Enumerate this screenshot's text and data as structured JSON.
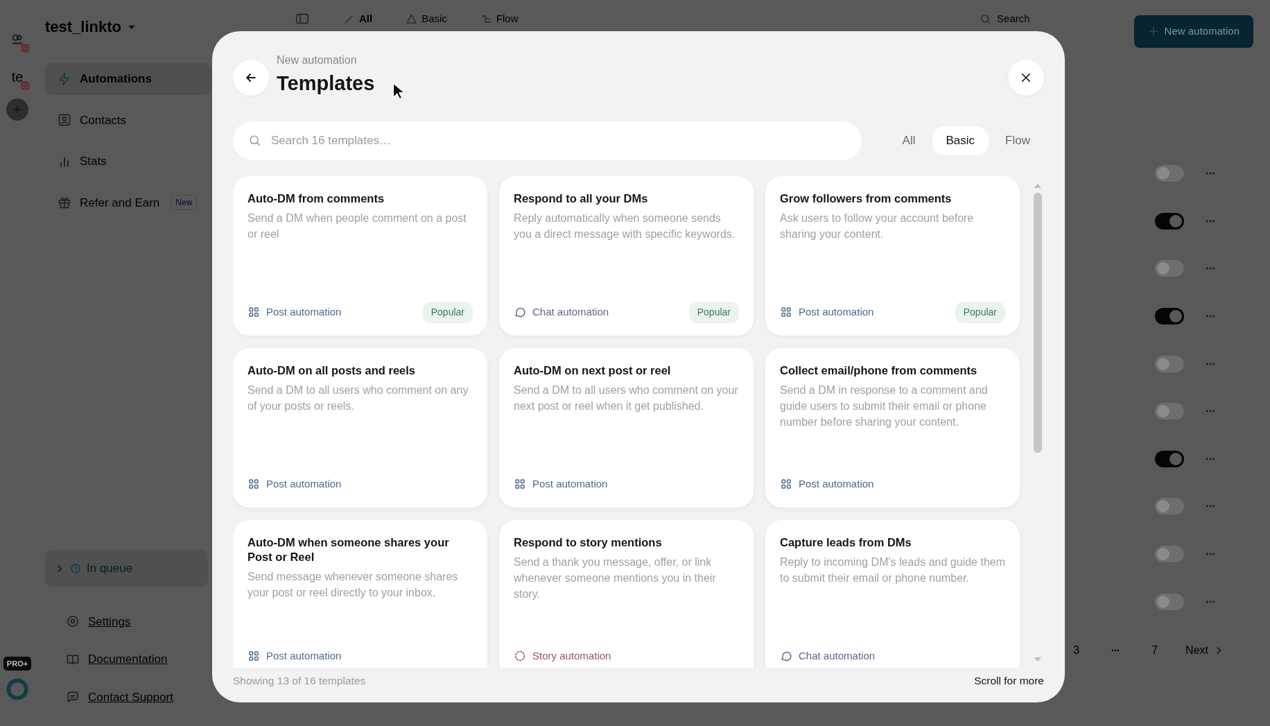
{
  "accounts": [
    {
      "kind": "logo"
    },
    {
      "kind": "initials",
      "initials": "te"
    }
  ],
  "workspace": "test_linkto",
  "nav": [
    {
      "label": "Automations",
      "selected": true
    },
    {
      "label": "Contacts",
      "selected": false
    },
    {
      "label": "Stats",
      "selected": false
    },
    {
      "label": "Refer and Earn",
      "selected": false,
      "badge": "New"
    }
  ],
  "queue": {
    "label": "In queue"
  },
  "footer_links": [
    "Settings",
    "Documentation",
    "Contact Support"
  ],
  "plan_badge": "PRO+",
  "topbar": {
    "tabs": [
      {
        "label": "All",
        "selected": true
      },
      {
        "label": "Basic",
        "selected": false
      },
      {
        "label": "Flow",
        "selected": false
      }
    ],
    "search_placeholder": "Search",
    "new_button": "New automation"
  },
  "automation_rows": [
    {
      "on": false
    },
    {
      "on": true
    },
    {
      "on": false
    },
    {
      "on": true
    },
    {
      "on": false
    },
    {
      "on": false
    },
    {
      "on": true
    },
    {
      "on": false
    },
    {
      "on": false
    },
    {
      "on": false
    }
  ],
  "pagination": {
    "pages": [
      "3",
      "7"
    ],
    "next": "Next"
  },
  "modal": {
    "subtitle": "New automation",
    "title": "Templates",
    "search_placeholder": "Search 16 templates…",
    "filters": [
      {
        "label": "All",
        "selected": false
      },
      {
        "label": "Basic",
        "selected": true
      },
      {
        "label": "Flow",
        "selected": false
      }
    ],
    "templates": [
      {
        "title": "Auto-DM from comments",
        "description": "Send a DM when people comment on a post or reel",
        "kind": "post",
        "category": "Post automation",
        "badge": "Popular"
      },
      {
        "title": "Respond to all your DMs",
        "description": "Reply automatically when someone sends you a direct message with specific keywords.",
        "kind": "chat",
        "category": "Chat automation",
        "badge": "Popular"
      },
      {
        "title": "Grow followers from comments",
        "description": "Ask users to follow your account before sharing your content.",
        "kind": "post",
        "category": "Post automation",
        "badge": "Popular"
      },
      {
        "title": "Auto-DM on all posts and reels",
        "description": "Send a DM to all users who comment on any of your posts or reels.",
        "kind": "post",
        "category": "Post automation"
      },
      {
        "title": "Auto-DM on next post or reel",
        "description": "Send a DM to all users who comment on your next post or reel when it get published.",
        "kind": "post",
        "category": "Post automation"
      },
      {
        "title": "Collect email/phone from comments",
        "description": "Send a DM in response to a comment and guide users to submit their email or phone number before sharing your content.",
        "kind": "post",
        "category": "Post automation"
      },
      {
        "title": "Auto-DM when someone shares your Post or Reel",
        "description": "Send message whenever someone shares your post or reel directly to your inbox.",
        "kind": "post",
        "category": "Post automation"
      },
      {
        "title": "Respond to story mentions",
        "description": "Send a thank you message, offer, or link whenever someone mentions you in their story.",
        "kind": "story",
        "category": "Story automation"
      },
      {
        "title": "Capture leads from DMs",
        "description": "Reply to incoming DM's leads and guide them to submit their email or phone number.",
        "kind": "chat",
        "category": "Chat automation"
      }
    ],
    "status": "Showing 13 of 16 templates",
    "scroll_hint": "Scroll for more"
  }
}
